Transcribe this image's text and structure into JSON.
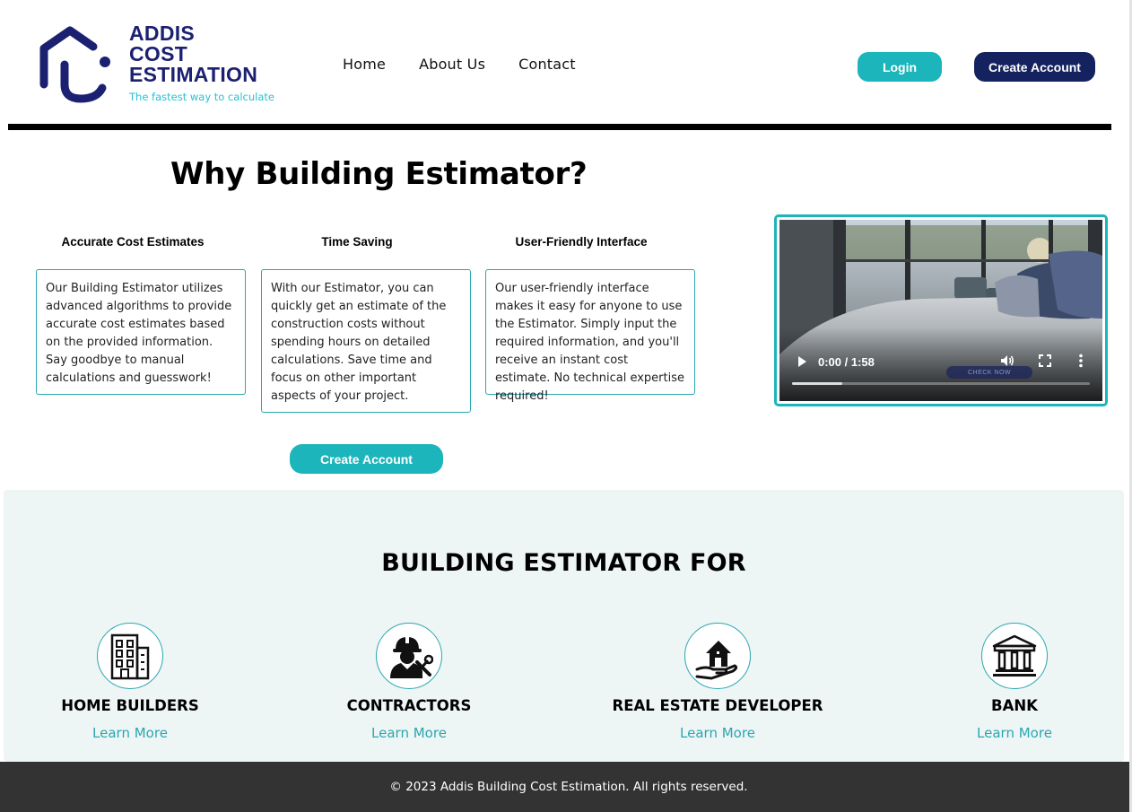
{
  "header": {
    "logo": {
      "line1": "ADDIS",
      "line2": "COST",
      "line3": "ESTIMATION",
      "tagline": "The fastest way to calculate"
    },
    "nav": [
      {
        "label": "Home"
      },
      {
        "label": "About Us"
      },
      {
        "label": "Contact"
      }
    ],
    "login_label": "Login",
    "create_account_label": "Create Account"
  },
  "why": {
    "title": "Why Building Estimator?",
    "features": [
      {
        "title": "Accurate Cost Estimates",
        "text": "Our Building Estimator utilizes advanced algorithms to provide accurate cost estimates based on the provided information. Say goodbye to manual calculations and guesswork!"
      },
      {
        "title": "Time Saving",
        "text": "With our Estimator, you can quickly get an estimate of the construction costs without spending hours on detailed calculations. Save time and focus on other important aspects of your project."
      },
      {
        "title": "User-Friendly Interface",
        "text": "Our user-friendly interface makes it easy for anyone to use the Estimator. Simply input the required information, and you'll receive an instant cost estimate. No technical expertise required!"
      }
    ],
    "create_account_label": "Create Account"
  },
  "video": {
    "time": "0:00 / 1:58",
    "progress": 0.17,
    "badge": "CHECK NOW"
  },
  "audience": {
    "title": "BUILDING ESTIMATOR FOR",
    "items": [
      {
        "label": "HOME BUILDERS",
        "link": "Learn More",
        "icon": "building-icon"
      },
      {
        "label": "CONTRACTORS",
        "link": "Learn More",
        "icon": "contractor-icon"
      },
      {
        "label": "REAL ESTATE DEVELOPER",
        "link": "Learn More",
        "icon": "house-hand-icon"
      },
      {
        "label": "BANK",
        "link": "Learn More",
        "icon": "bank-icon"
      }
    ]
  },
  "footer": {
    "text": "© 2023 Addis Building Cost Estimation. All rights reserved."
  },
  "colors": {
    "accent": "#1bb5bb",
    "brand": "#1b2170",
    "dark_button": "#14235f",
    "footer": "#333333",
    "section_bg": "#eef5f5"
  }
}
